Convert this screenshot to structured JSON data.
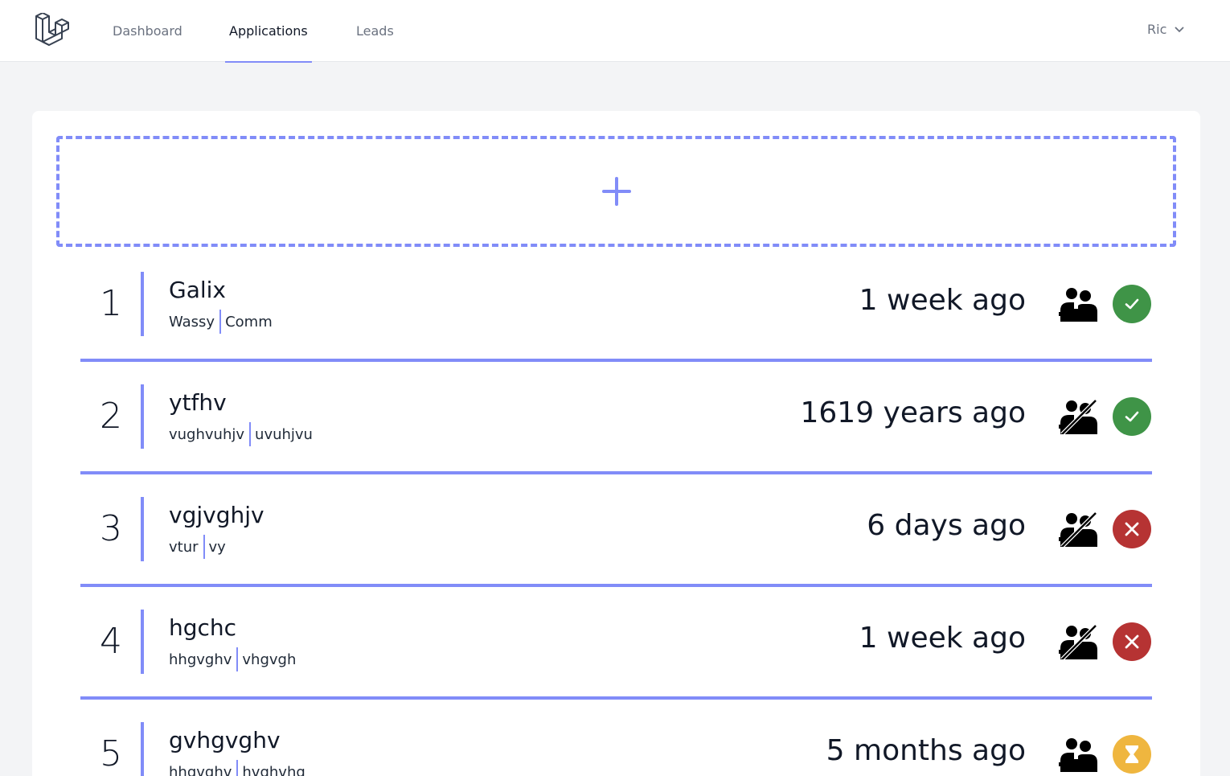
{
  "nav": {
    "links": [
      {
        "label": "Dashboard",
        "active": false
      },
      {
        "label": "Applications",
        "active": true
      },
      {
        "label": "Leads",
        "active": false
      }
    ],
    "user": "Ric"
  },
  "colors": {
    "accent": "#818cf8",
    "accepted": "#3f9447",
    "rejected": "#b63333",
    "pending": "#efb63f"
  },
  "add_button": {
    "icon": "plus-icon"
  },
  "applications": [
    {
      "index": "1",
      "title": "Galix",
      "left": "Wassy",
      "right": "Comm",
      "time": "1 week ago",
      "meeting": "meeting-icon",
      "status": "accepted"
    },
    {
      "index": "2",
      "title": "ytfhv",
      "left": "vughvuhjv",
      "right": "uvuhjvu",
      "time": "1619 years ago",
      "meeting": "no-meeting-icon",
      "status": "accepted"
    },
    {
      "index": "3",
      "title": "vgjvghjv",
      "left": "vtur",
      "right": "vy",
      "time": "6 days ago",
      "meeting": "no-meeting-icon",
      "status": "rejected"
    },
    {
      "index": "4",
      "title": "hgchc",
      "left": "hhgvghv",
      "right": "vhgvgh",
      "time": "1 week ago",
      "meeting": "no-meeting-icon",
      "status": "rejected"
    },
    {
      "index": "5",
      "title": "gvhgvghv",
      "left": "hhgvghv",
      "right": "hvghvhg",
      "time": "5 months ago",
      "meeting": "meeting-icon",
      "status": "pending"
    }
  ]
}
